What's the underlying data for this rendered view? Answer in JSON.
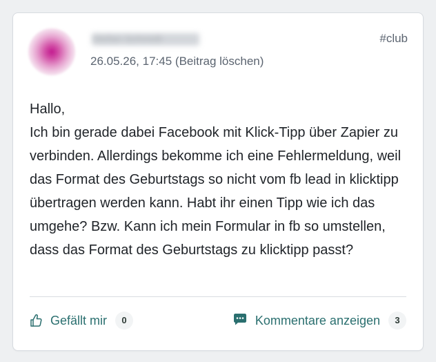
{
  "post": {
    "author_name": "Stefan Schmidt",
    "date_time": "26.05.26, 17:45",
    "delete_label": "(Beitrag löschen)",
    "tag": "#club",
    "body_lines": [
      "Hallo,",
      "Ich bin gerade dabei Facebook mit Klick-Tipp über Zapier zu verbinden. Allerdings bekomme ich eine Fehlermeldung, weil das Format des Geburtstags so nicht vom fb lead in klicktipp übertragen werden kann. Habt ihr einen Tipp wie ich das umgehe? Bzw. Kann ich mein Formular in fb so umstellen, dass das Format des Geburtstags zu klicktipp passt?"
    ]
  },
  "footer": {
    "like_label": "Gefällt mir",
    "like_count": "0",
    "comments_label": "Kommentare anzeigen",
    "comments_count": "3"
  },
  "colors": {
    "accent": "#2a6f6f",
    "muted_text": "#5b6470",
    "avatar": "#c2188f"
  },
  "icons": {
    "like": "thumbs-up-icon",
    "comments": "comment-icon"
  }
}
